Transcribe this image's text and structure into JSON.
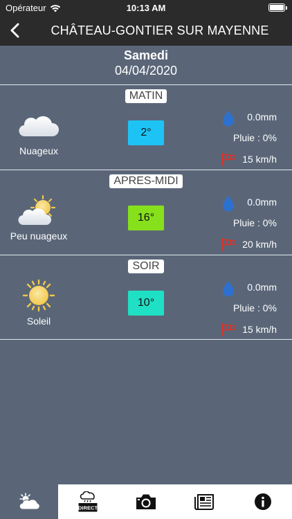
{
  "status_bar": {
    "carrier": "Opérateur",
    "time": "10:13 AM"
  },
  "header": {
    "title": "CHÂTEAU-GONTIER SUR MAYENNE"
  },
  "date": {
    "day": "Samedi",
    "value": "04/04/2020"
  },
  "periods": [
    {
      "name": "MATIN",
      "condition": "Nuageux",
      "icon": "cloud-icon",
      "temperature": "2°",
      "temp_color": "#1ec3f5",
      "rain": "0.0mm",
      "rain_probability": "Pluie : 0%",
      "wind": "15 km/h"
    },
    {
      "name": "APRES-MIDI",
      "condition": "Peu nuageux",
      "icon": "partly-cloudy-icon",
      "temperature": "16°",
      "temp_color": "#86e01c",
      "rain": "0.0mm",
      "rain_probability": "Pluie : 0%",
      "wind": "20 km/h"
    },
    {
      "name": "SOIR",
      "condition": "Soleil",
      "icon": "sun-icon",
      "temperature": "10°",
      "temp_color": "#1fe0c4",
      "rain": "0.0mm",
      "rain_probability": "Pluie : 0%",
      "wind": "15 km/h"
    }
  ],
  "tab_bar": {
    "items": [
      {
        "icon": "weather-icon",
        "active": true
      },
      {
        "icon": "direct-icon",
        "label": "DIRECT"
      },
      {
        "icon": "camera-icon"
      },
      {
        "icon": "news-icon"
      },
      {
        "icon": "info-icon"
      }
    ]
  },
  "colors": {
    "background": "#5a6678",
    "nav": "#2b2b2b",
    "drop": "#2d71d0",
    "wind": "#d8322a"
  }
}
